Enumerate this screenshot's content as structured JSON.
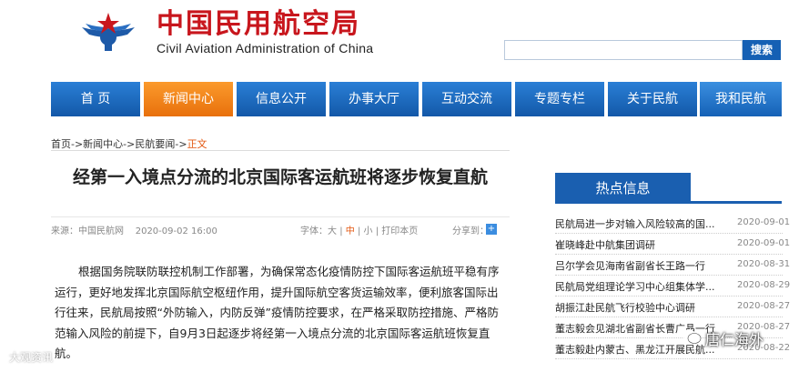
{
  "header": {
    "site_name_cn": "中国民用航空局",
    "site_name_en": "Civil Aviation Administration of China",
    "search_placeholder": "",
    "search_button": "搜索"
  },
  "nav": {
    "items": [
      {
        "label": "首 页"
      },
      {
        "label": "新闻中心"
      },
      {
        "label": "信息公开"
      },
      {
        "label": "办事大厅"
      },
      {
        "label": "互动交流"
      },
      {
        "label": "专题专栏"
      },
      {
        "label": "关于民航"
      },
      {
        "label": "我和民航"
      }
    ]
  },
  "breadcrumb": {
    "path": "首页->新闻中心->民航要闻->",
    "current": "正文"
  },
  "article": {
    "title": "经第一入境点分流的北京国际客运航班将逐步恢复直航",
    "source": "来源：中国民航网",
    "date": "2020-09-02 16:00",
    "fontsize_label": "字体：",
    "size_large": "大",
    "size_mid": "中",
    "size_small": "小",
    "sep": "|",
    "print": "打印本页",
    "share": "分享到：",
    "body": "根据国务院联防联控机制工作部署，为确保常态化疫情防控下国际客运航班平稳有序运行，更好地发挥北京国际航空枢纽作用，提升国际航空客货运输效率，便利旅客国际出行往来，民航局按照“外防输入，内防反弹”疫情防控要求，在严格采取防控措施、严格防范输入风险的前提下，自9月3日起逐步将经第一入境点分流的北京国际客运航班恢复直航。"
  },
  "sidebar": {
    "heading": "热点信息",
    "items": [
      {
        "title": "民航局进一步对输入风险较高的国...",
        "date": "2020-09-01"
      },
      {
        "title": "崔晓峰赴中航集团调研",
        "date": "2020-09-01"
      },
      {
        "title": "吕尔学会见海南省副省长王路一行",
        "date": "2020-08-31"
      },
      {
        "title": "民航局党组理论学习中心组集体学...",
        "date": "2020-08-29"
      },
      {
        "title": "胡振江赴民航飞行校验中心调研",
        "date": "2020-08-27"
      },
      {
        "title": "董志毅会见湖北省副省长曹广晶一行",
        "date": "2020-08-27"
      },
      {
        "title": "董志毅赴内蒙古、黑龙江开展民航...",
        "date": "2020-08-22"
      }
    ]
  },
  "watermarks": {
    "left": "大观资讯",
    "right": "唐仁海外"
  },
  "colors": {
    "brand_red": "#c8161d",
    "nav_blue": "#1a66bf",
    "nav_active": "#f28a1e",
    "accent_orange": "#e3560f"
  }
}
